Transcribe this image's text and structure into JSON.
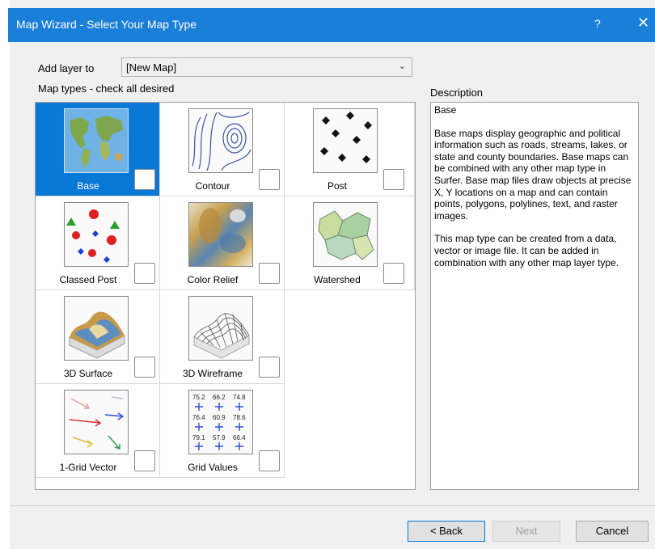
{
  "window": {
    "title": "Map Wizard - Select Your Map Type",
    "help_glyph": "?",
    "close_glyph": "✕"
  },
  "add_layer": {
    "label": "Add layer to",
    "value": "[New Map]"
  },
  "map_types_label": "Map types - check all desired",
  "map_types": [
    {
      "label": "Base",
      "selected": true,
      "checked": false
    },
    {
      "label": "Contour",
      "selected": false,
      "checked": false
    },
    {
      "label": "Post",
      "selected": false,
      "checked": false
    },
    {
      "label": "Classed Post",
      "selected": false,
      "checked": false
    },
    {
      "label": "Color Relief",
      "selected": false,
      "checked": false
    },
    {
      "label": "Watershed",
      "selected": false,
      "checked": false
    },
    {
      "label": "3D Surface",
      "selected": false,
      "checked": false
    },
    {
      "label": "3D Wireframe",
      "selected": false,
      "checked": false
    },
    {
      "label": "1-Grid Vector",
      "selected": false,
      "checked": false
    },
    {
      "label": "Grid Values",
      "selected": false,
      "checked": false
    }
  ],
  "grid_values_thumb": [
    "75.2",
    "66.2",
    "74.8",
    "76.4",
    "60.9",
    "78.6",
    "79.1",
    "57.9",
    "66.4"
  ],
  "description": {
    "label": "Description",
    "heading": "Base",
    "para1": "Base maps display geographic and political information such as roads, streams, lakes, or state and county boundaries. Base maps can be combined with any other map type in Surfer. Base map files draw objects at precise X, Y locations on a map and can contain points, polygons, polylines, text, and raster images.",
    "para2": "This map type can be created from a data, vector or image file. It can be added in combination with any other map layer type."
  },
  "buttons": {
    "back": "< Back",
    "next": "Next",
    "cancel": "Cancel"
  }
}
